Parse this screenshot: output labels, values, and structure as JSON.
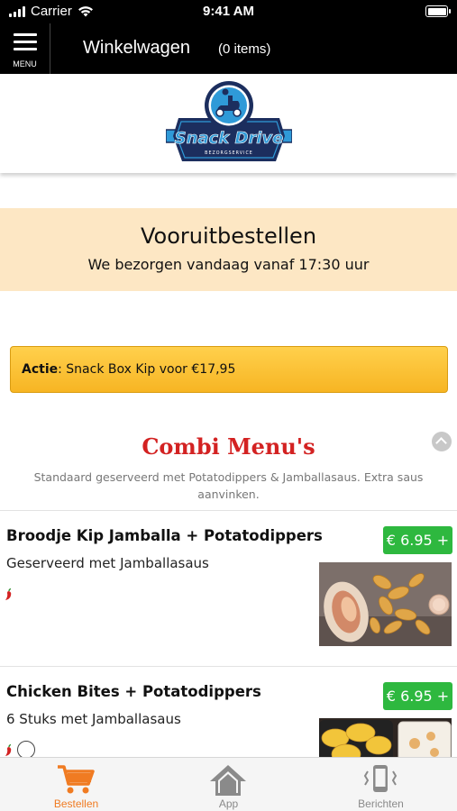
{
  "status_bar": {
    "carrier": "Carrier",
    "time": "9:41 AM",
    "battery_level": 1.0
  },
  "nav": {
    "menu_label": "MENU",
    "title": "Winkelwagen",
    "cart_count": "(0 items)"
  },
  "logo": {
    "brand": "Snack Drive",
    "tagline": "BEZORGSERVICE",
    "colors": {
      "navy": "#1c2e5e",
      "blue": "#2f9ad8"
    }
  },
  "banner": {
    "title": "Vooruitbestellen",
    "subtitle": "We bezorgen vandaag vanaf 17:30 uur",
    "background": "#fde7c4"
  },
  "action": {
    "label": "Actie",
    "text": ": Snack Box Kip voor €17,95",
    "color": "#fbc02d"
  },
  "category": {
    "title": "Combi Menu's",
    "description": "Standaard geserveerd met Potatodippers & Jamballasaus. Extra saus aanvinken.",
    "title_color": "#d32222"
  },
  "products": [
    {
      "name": "Broodje Kip Jamballa + Potatodippers",
      "description": "Geserveerd met Jamballasaus",
      "price": "€ 6.95 +",
      "icons": [
        "pepper-icon"
      ]
    },
    {
      "name": "Chicken Bites + Potatodippers",
      "description": "6 Stuks met Jamballasaus",
      "price": "€ 6.95 +",
      "icons": [
        "pepper-icon",
        "halal-icon"
      ]
    }
  ],
  "price_color": "#2eb83f",
  "tabs": [
    {
      "label": "Bestellen",
      "icon": "cart-icon",
      "active": true
    },
    {
      "label": "App",
      "icon": "home-icon",
      "active": false
    },
    {
      "label": "Berichten",
      "icon": "phone-vibrate-icon",
      "active": false
    }
  ],
  "active_tab_color": "#f07b22"
}
